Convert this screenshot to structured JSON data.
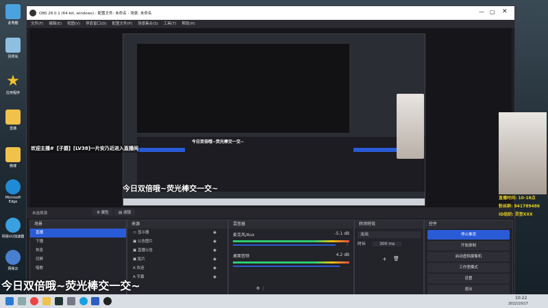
{
  "desktop": {
    "icons": [
      {
        "label": "此电脑",
        "icon": "monitor-icon",
        "color": "#4aa3df"
      },
      {
        "label": "回收站",
        "icon": "recycle-bin-icon",
        "color": "#8fbfe0"
      },
      {
        "label": "应用程序",
        "icon": "star-icon",
        "color": "#f2c230"
      },
      {
        "label": "直播",
        "icon": "folder-icon",
        "color": "#f0c24a"
      },
      {
        "label": "微博",
        "icon": "folder-icon",
        "color": "#f0c24a"
      },
      {
        "label": "游戏 - 快捷方式",
        "icon": "folder-icon",
        "color": "#f0c24a"
      },
      {
        "label": "Microsoft Edge",
        "icon": "edge-icon",
        "color": "#1f8bd6"
      },
      {
        "label": "网易UU加速器",
        "icon": "q-icon",
        "color": "#3aa0e0"
      },
      {
        "label": "网易云",
        "icon": "c-icon",
        "color": "#4a7fd0"
      }
    ]
  },
  "obs": {
    "title": "OBS 28.0.1 (64-bit, windows) - 配置文件: 未命名 - 场景: 未命名",
    "menu": [
      "文件(F)",
      "编辑(E)",
      "视图(V)",
      "停靠窗口(D)",
      "配置文件(P)",
      "场景集合(S)",
      "工具(T)",
      "帮助(H)"
    ],
    "preview_banner": "欢迎主播#【子爵】[LV38]一片安乃近进入直播间",
    "subtitle_overlay": "今日双倍哦~荧光棒交一交~",
    "mini_subtitle": "今日双倍哦~荧光棒交一交~",
    "no_source_label": "未选择源",
    "props_button": "属性",
    "filters_button": "滤镜",
    "right_overlay": [
      "直播时间: 10-18点",
      "粉丝群: 841789486",
      "ID组织: 灵签XXX"
    ],
    "scenes": {
      "header": "场景",
      "items": [
        "直播",
        "下播",
        "休息",
        "切屏",
        "唱歌"
      ]
    },
    "sources": {
      "header": "来源",
      "items": [
        "显示器",
        "公告图片",
        "直播公告",
        "贴片",
        "欢迎",
        "字幕"
      ]
    },
    "mixer": {
      "header": "混音器",
      "channels": [
        {
          "name": "麦克风/Aux",
          "db": "-5.1 dB"
        },
        {
          "name": "桌面音频",
          "db": "4.2 dB"
        }
      ],
      "scale": [
        "-60",
        "-55",
        "-50",
        "-45",
        "-40",
        "-35",
        "-30",
        "-25",
        "-20",
        "-15",
        "-10",
        "-5",
        "0"
      ]
    },
    "transitions": {
      "header": "转场特效",
      "type": "淡出",
      "duration_label": "时长",
      "duration": "300 ms"
    },
    "controls": {
      "header": "控件",
      "buttons": [
        "停止推流",
        "开始录制",
        "启动虚拟摄像机",
        "工作室模式",
        "设置",
        "退出"
      ]
    },
    "statusbar": "Ln 1 / 1  00:00:00 / 直播 00:00:00  CPU: 2.3%, 30.00 fps"
  },
  "taskbar": {
    "time": "10:22",
    "date": "2022/10/17",
    "icons": [
      "windows-start-icon",
      "search-icon",
      "chrome-icon",
      "folder-icon",
      "steam-icon",
      "settings-icon",
      "qq-icon",
      "word-icon"
    ]
  },
  "colors": {
    "accent": "#2a5bd7",
    "obs_bg": "#1e1e24",
    "meter_green": "#2ecc71",
    "meter_red": "#e74c3c"
  }
}
